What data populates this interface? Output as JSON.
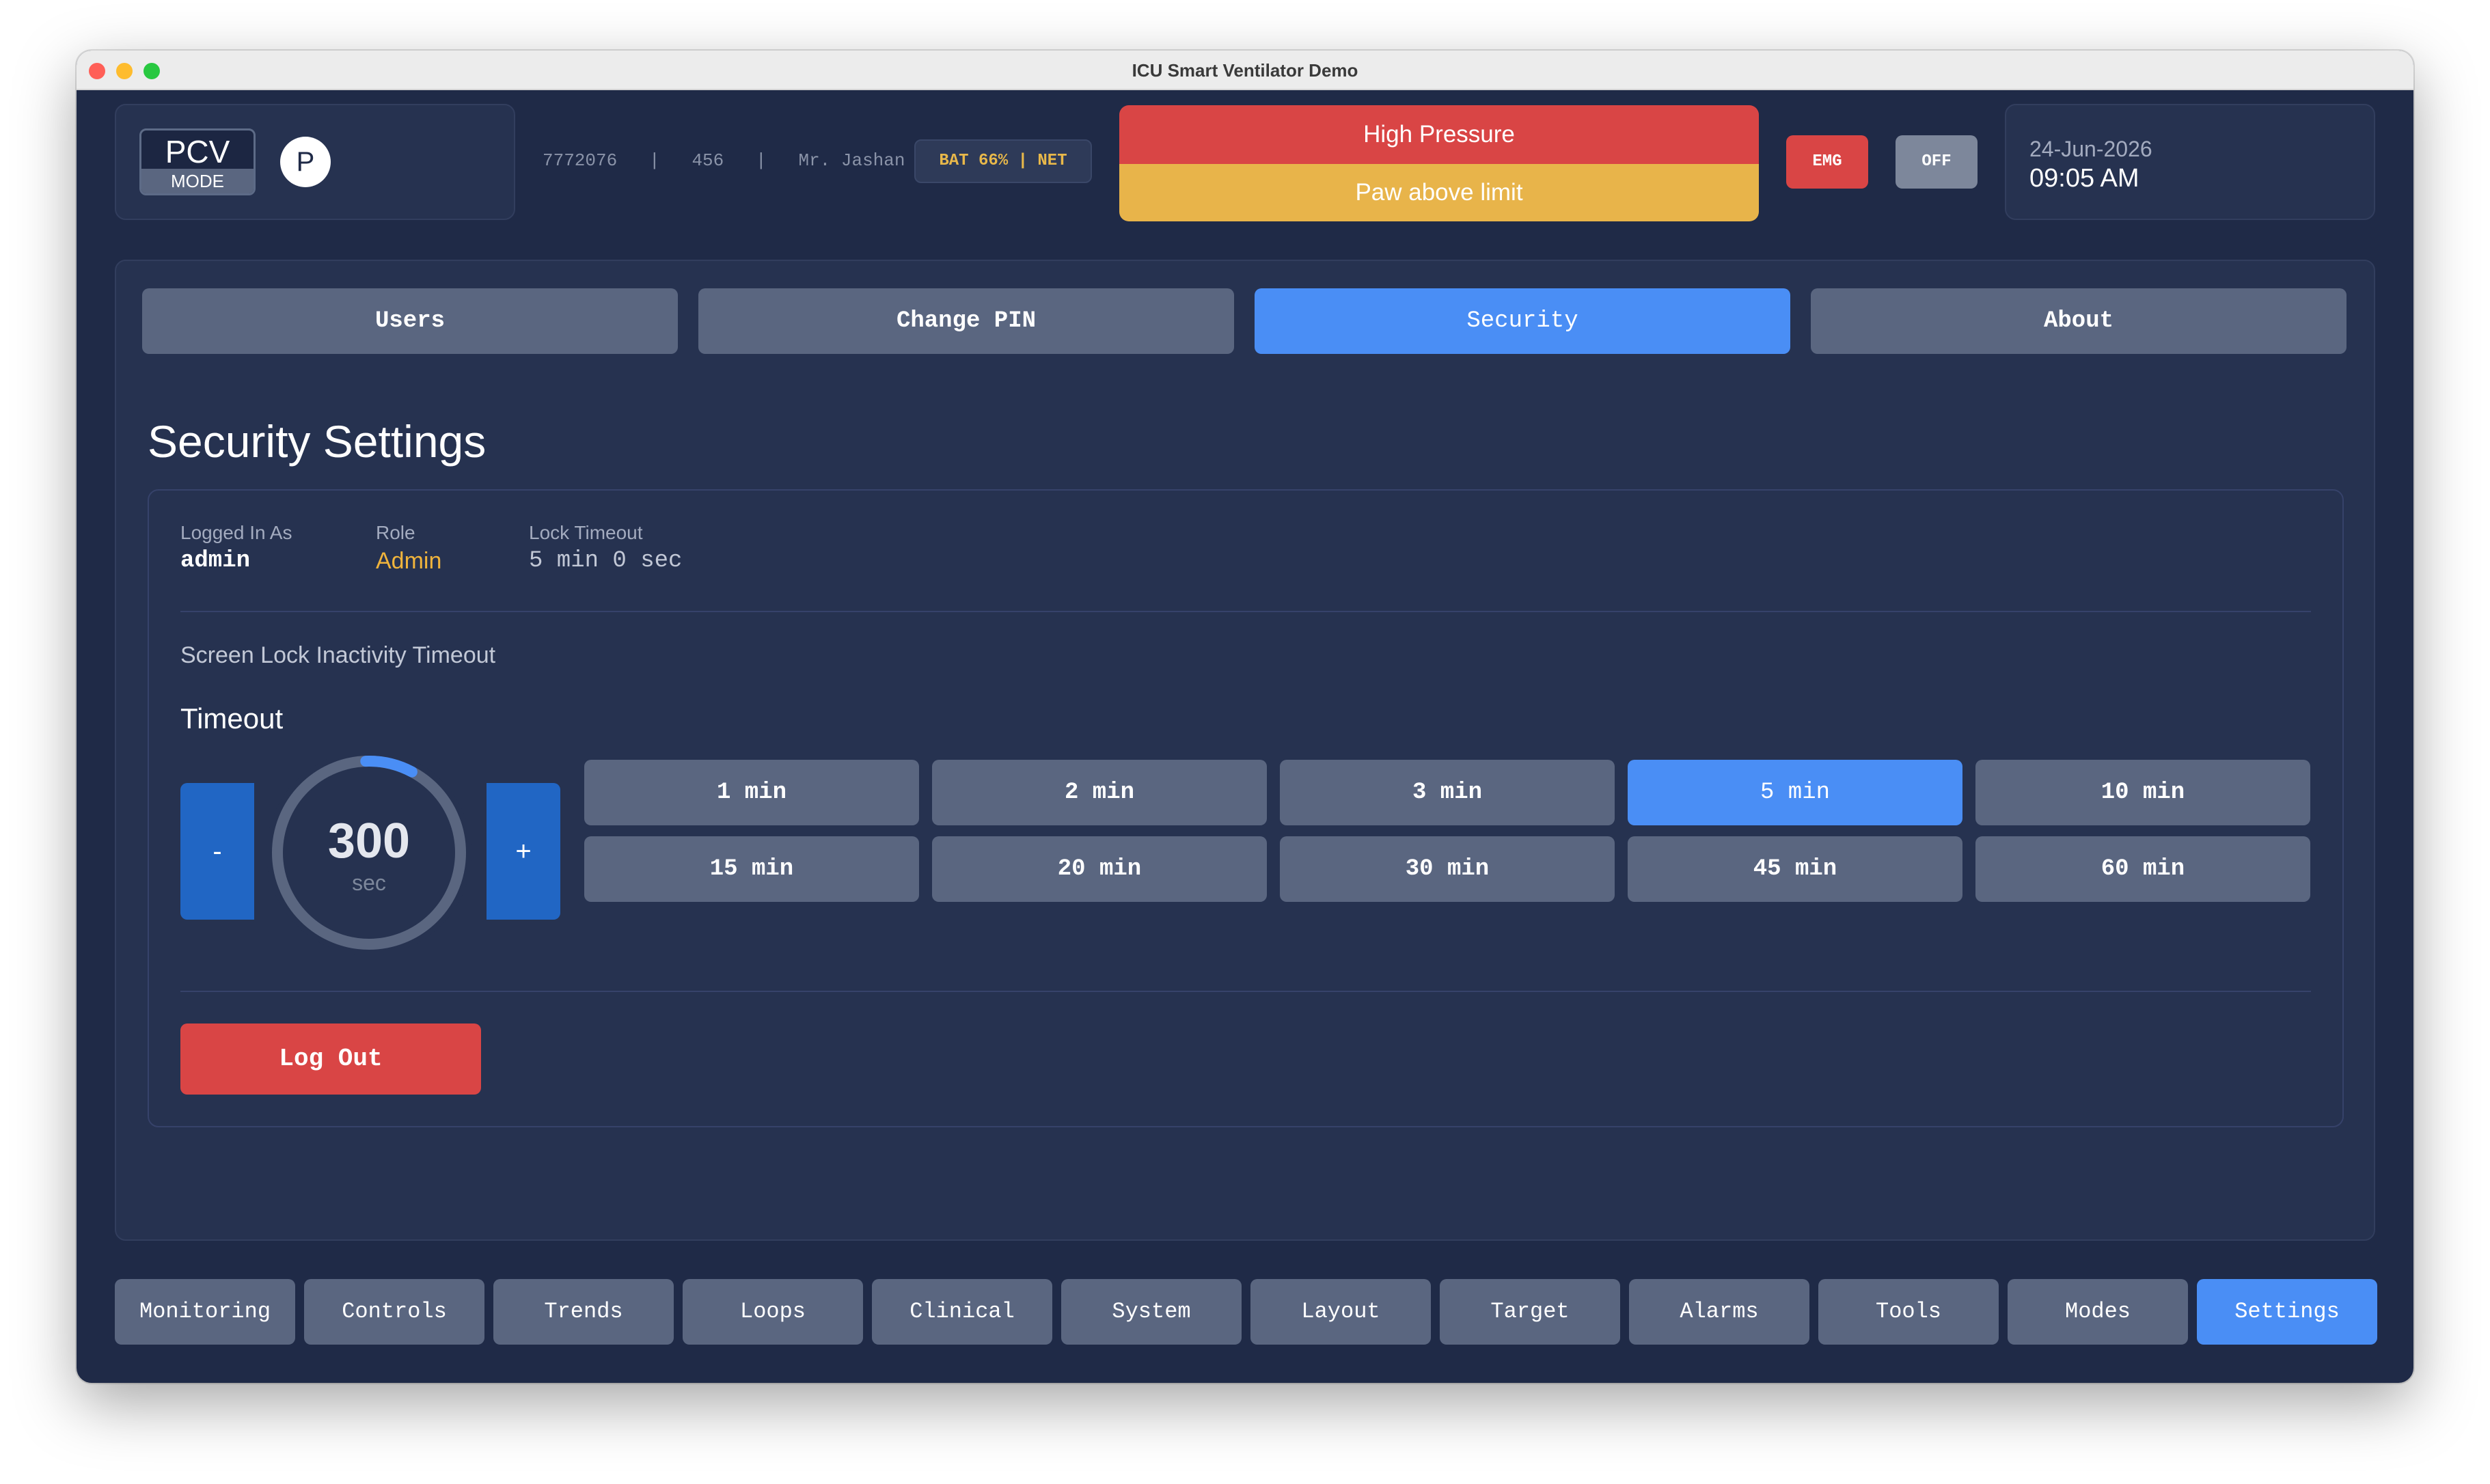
{
  "window": {
    "title": "ICU Smart Ventilator Demo"
  },
  "header": {
    "mode": {
      "name": "PCV",
      "label": "MODE",
      "letter": "P"
    },
    "patient": {
      "id": "7772076",
      "bed": "456",
      "name": "Mr. Jashan"
    },
    "status_chip": "BAT 66% | NET",
    "alarms": {
      "primary": "High Pressure",
      "secondary": "Paw above limit"
    },
    "emg_label": "EMG",
    "off_label": "OFF",
    "date": "24-Jun-2026",
    "time": "09:05 AM"
  },
  "tabs": [
    {
      "label": "Users",
      "active": false
    },
    {
      "label": "Change PIN",
      "active": false
    },
    {
      "label": "Security",
      "active": true
    },
    {
      "label": "About",
      "active": false
    }
  ],
  "security": {
    "title": "Security Settings",
    "logged_in_label": "Logged In As",
    "logged_in_value": "admin",
    "role_label": "Role",
    "role_value": "Admin",
    "lock_label": "Lock Timeout",
    "lock_value": "5 min 0 sec",
    "inactivity_title": "Screen Lock Inactivity Timeout",
    "timeout_title": "Timeout",
    "minus_label": "-",
    "plus_label": "+",
    "timeout_value": "300",
    "timeout_unit": "sec",
    "options": [
      {
        "label": "1 min",
        "active": false
      },
      {
        "label": "2 min",
        "active": false
      },
      {
        "label": "3 min",
        "active": false
      },
      {
        "label": "5 min",
        "active": true
      },
      {
        "label": "10 min",
        "active": false
      },
      {
        "label": "15 min",
        "active": false
      },
      {
        "label": "20 min",
        "active": false
      },
      {
        "label": "30 min",
        "active": false
      },
      {
        "label": "45 min",
        "active": false
      },
      {
        "label": "60 min",
        "active": false
      }
    ],
    "logout_label": "Log Out"
  },
  "nav": [
    {
      "label": "Monitoring",
      "active": false
    },
    {
      "label": "Controls",
      "active": false
    },
    {
      "label": "Trends",
      "active": false
    },
    {
      "label": "Loops",
      "active": false
    },
    {
      "label": "Clinical",
      "active": false
    },
    {
      "label": "System",
      "active": false
    },
    {
      "label": "Layout",
      "active": false
    },
    {
      "label": "Target",
      "active": false
    },
    {
      "label": "Alarms",
      "active": false
    },
    {
      "label": "Tools",
      "active": false
    },
    {
      "label": "Modes",
      "active": false
    },
    {
      "label": "Settings",
      "active": true
    }
  ],
  "colors": {
    "accent": "#4a8ef5",
    "danger": "#d94545",
    "warning": "#e8b44a",
    "role": "#f0b43c"
  }
}
